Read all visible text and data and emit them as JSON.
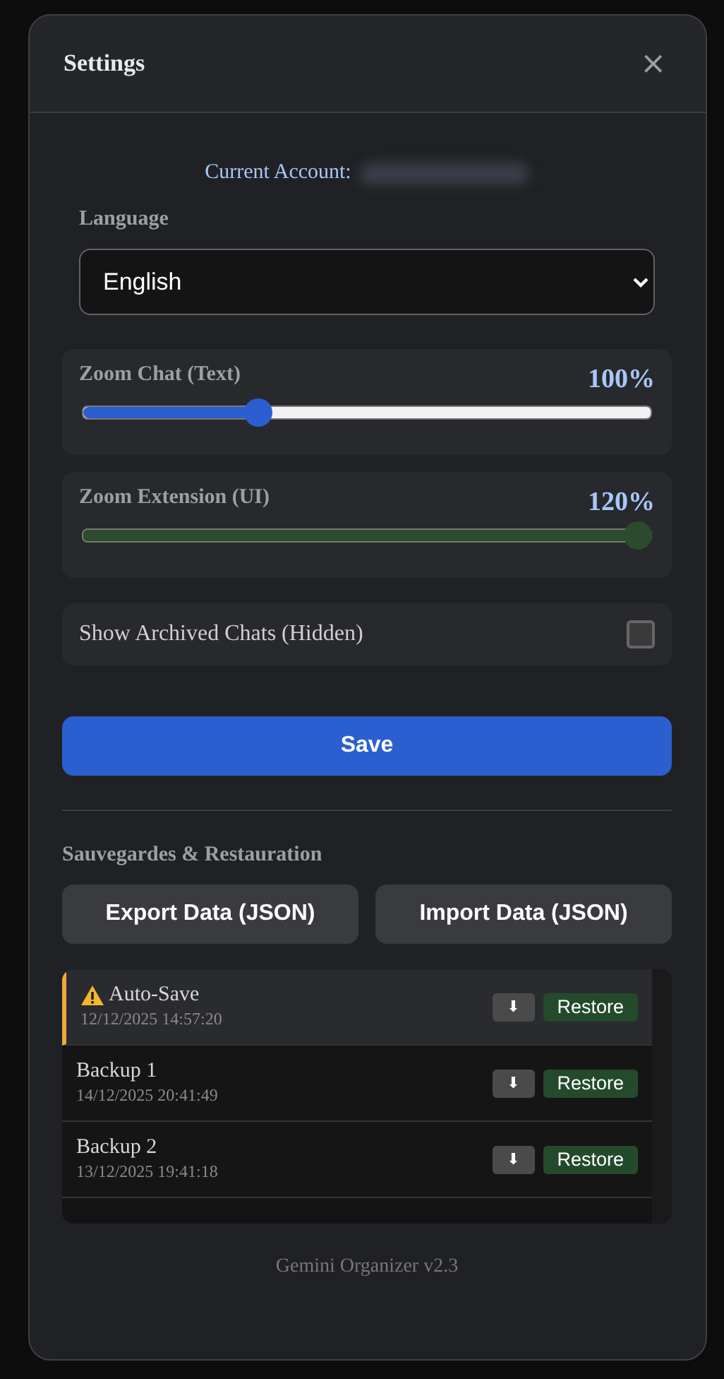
{
  "dialog": {
    "title": "Settings",
    "close": "×"
  },
  "account": {
    "label": "Current Account:"
  },
  "language": {
    "label": "Language",
    "value": "English"
  },
  "sliders": [
    {
      "label": "Zoom Chat (Text)",
      "reading": "100%",
      "level": 0.3,
      "kind": "blue"
    },
    {
      "label": "Zoom Extension (UI)",
      "reading": "120%",
      "level": 1,
      "kind": "green"
    }
  ],
  "archived": {
    "label": "Show Archived Chats (Hidden)",
    "checked": false
  },
  "save_button": "Save",
  "backups": {
    "title": "Sauvegardes & Restauration",
    "export": "Export Data (JSON)",
    "import": "Import Data (JSON)",
    "items": [
      {
        "kind": "auto",
        "name": "Auto-Save",
        "date": "12/12/2025 14:57:20",
        "download": "⬇",
        "restore": "Restore"
      },
      {
        "kind": "backup",
        "name": "Backup 1",
        "date": "14/12/2025 20:41:49",
        "download": "⬇",
        "restore": "Restore"
      },
      {
        "kind": "backup",
        "name": "Backup 2",
        "date": "13/12/2025 19:41:18",
        "download": "⬇",
        "restore": "Restore"
      }
    ]
  },
  "footer": "Gemini Organizer v2.3"
}
